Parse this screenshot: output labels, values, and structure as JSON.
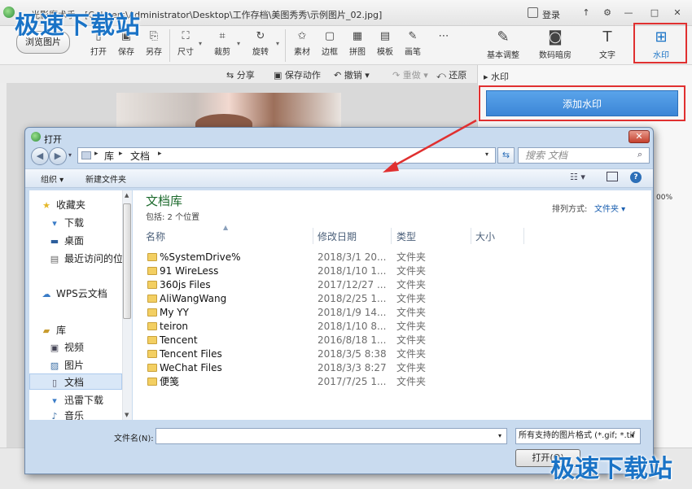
{
  "app": {
    "title": "光影魔术手 - [C:\\Users\\Administrator\\Desktop\\工作存档\\美图秀秀\\示例图片_02.jpg]",
    "login_label": "登录",
    "window_buttons": [
      "↑",
      "⚙",
      "—",
      "□",
      "✕"
    ],
    "browse_button": "浏览图片",
    "toolbar": [
      {
        "label": "打开",
        "icon": "open-icon"
      },
      {
        "label": "保存",
        "icon": "save-icon"
      },
      {
        "label": "另存",
        "icon": "save-as-icon"
      },
      {
        "label": "尺寸",
        "icon": "resize-icon"
      },
      {
        "label": "裁剪",
        "icon": "crop-icon"
      },
      {
        "label": "旋转",
        "icon": "rotate-icon"
      },
      {
        "label": "素材",
        "icon": "material-icon"
      },
      {
        "label": "边框",
        "icon": "border-icon"
      },
      {
        "label": "拼图",
        "icon": "collage-icon"
      },
      {
        "label": "模板",
        "icon": "template-icon"
      },
      {
        "label": "画笔",
        "icon": "brush-icon"
      },
      {
        "label": "",
        "icon": "more-icon"
      }
    ],
    "subbar": {
      "share": "分享",
      "save_action": "保存动作",
      "undo": "撤销",
      "redo": "重做",
      "restore": "还原"
    },
    "right_tabs": [
      {
        "label": "基本调整",
        "icon": "adjust-icon"
      },
      {
        "label": "数码暗房",
        "icon": "darkroom-icon"
      },
      {
        "label": "文字",
        "icon": "text-icon"
      },
      {
        "label": "水印",
        "icon": "watermark-icon",
        "active": true
      }
    ],
    "panel_section": "水印",
    "add_watermark_button": "添加水印",
    "zoom_readout": "00%",
    "highlight_color": "#e03030",
    "accent_color": "#1a73c6"
  },
  "overlay_logo": "极速下载站",
  "dialog": {
    "title": "打开",
    "close": "✕",
    "address": {
      "crumbs": [
        "库",
        "文档"
      ]
    },
    "search_placeholder": "搜索 文档",
    "commands": {
      "organize": "组织 ▾",
      "new_folder": "新建文件夹"
    },
    "nav": {
      "favorites_header": "收藏夹",
      "favorites": [
        "下载",
        "桌面",
        "最近访问的位置"
      ],
      "wps": "WPS云文档",
      "libraries_header": "库",
      "libraries": [
        "视频",
        "图片",
        "文档",
        "迅雷下载",
        "音乐"
      ]
    },
    "library_title": "文档库",
    "library_sub": "包括: 2 个位置",
    "arrange_label": "排列方式:",
    "arrange_value": "文件夹 ▾",
    "columns": [
      "名称",
      "修改日期",
      "类型",
      "大小"
    ],
    "rows": [
      {
        "name": "%SystemDrive%",
        "date": "2018/3/1 20...",
        "type": "文件夹"
      },
      {
        "name": "91 WireLess",
        "date": "2018/1/10 1...",
        "type": "文件夹"
      },
      {
        "name": "360js Files",
        "date": "2017/12/27 ...",
        "type": "文件夹"
      },
      {
        "name": "AliWangWang",
        "date": "2018/2/25 1...",
        "type": "文件夹"
      },
      {
        "name": "My YY",
        "date": "2018/1/9 14...",
        "type": "文件夹"
      },
      {
        "name": "teiron",
        "date": "2018/1/10 8...",
        "type": "文件夹"
      },
      {
        "name": "Tencent",
        "date": "2016/8/18 1...",
        "type": "文件夹"
      },
      {
        "name": "Tencent Files",
        "date": "2018/3/5 8:38",
        "type": "文件夹"
      },
      {
        "name": "WeChat Files",
        "date": "2018/3/3 8:27",
        "type": "文件夹"
      },
      {
        "name": "便笺",
        "date": "2017/7/25 1...",
        "type": "文件夹"
      }
    ],
    "filename_label": "文件名(N):",
    "filename_value": "",
    "filetype": "所有支持的图片格式 (*.gif; *.tif",
    "open_button": "打开(O)"
  }
}
